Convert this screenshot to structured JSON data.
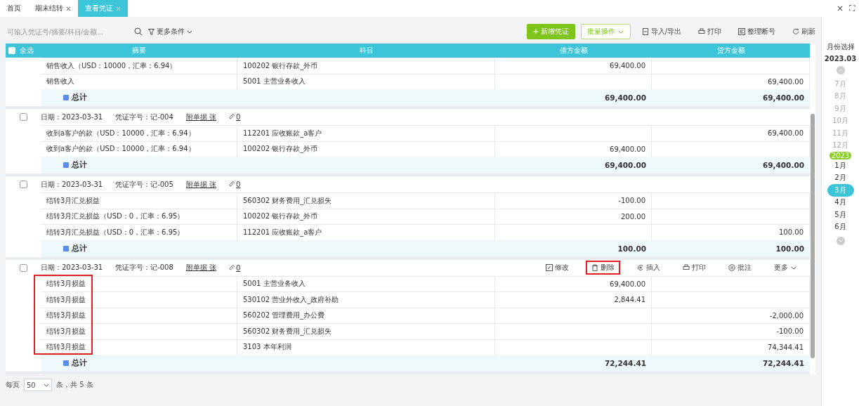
{
  "tabs": [
    {
      "label": "首页",
      "closable": false,
      "selected": false
    },
    {
      "label": "期末结转",
      "closable": true,
      "selected": false
    },
    {
      "label": "查看凭证",
      "closable": true,
      "selected": true
    }
  ],
  "window_controls": [
    "×",
    "⛶"
  ],
  "search": {
    "placeholder": "可输入凭证号/摘要/科目/金额..."
  },
  "filter": {
    "label": "更多条件"
  },
  "toolbar": [
    {
      "label": "新增凭证",
      "kind": "primary"
    },
    {
      "label": "批量操作",
      "kind": "outline"
    },
    {
      "label": "导入/导出",
      "kind": "import"
    },
    {
      "label": "打印",
      "kind": "print"
    },
    {
      "label": "整理断号",
      "kind": "renumber"
    },
    {
      "label": "刷新",
      "kind": "refresh"
    }
  ],
  "table": {
    "select_all": {
      "label": "全选",
      "checked": false
    },
    "columns": [
      "摘要",
      "科目",
      "借方金额",
      "贷方金额"
    ],
    "groups": [
      {
        "rows": [
          {
            "summary": "销售收入（USD：10000，汇率：6.94）",
            "account": "100202 银行存款_外币",
            "debit": "69,400.00",
            "credit": ""
          },
          {
            "summary": "销售收入",
            "account": "5001 主营业务收入",
            "debit": "",
            "credit": "69,400.00"
          }
        ],
        "total": {
          "label": "总计",
          "debit": "69,400.00",
          "credit": "69,400.00"
        }
      },
      {
        "header": {
          "date": "日期：2023-03-31",
          "number": "凭证字号：记-004",
          "attachments": "附单据 张",
          "files": "0"
        },
        "checked": false,
        "rows": [
          {
            "summary": "收到a客户的款（USD：10000，汇率：6.94）",
            "account": "112201 应收账款_a客户",
            "debit": "",
            "credit": "69,400.00"
          },
          {
            "summary": "收到a客户的款（USD：10000，汇率：6.94）",
            "account": "100202 银行存款_外币",
            "debit": "69,400.00",
            "credit": ""
          }
        ],
        "total": {
          "label": "总计",
          "debit": "69,400.00",
          "credit": "69,400.00"
        }
      },
      {
        "header": {
          "date": "日期：2023-03-31",
          "number": "凭证字号：记-005",
          "attachments": "附单据 张",
          "files": "0"
        },
        "checked": false,
        "rows": [
          {
            "summary": "结转3月汇兑损益",
            "account": "560302 财务费用_汇兑损失",
            "debit": "-100.00",
            "credit": ""
          },
          {
            "summary": "结转3月汇兑损益（USD：0，汇率：6.95）",
            "account": "100202 银行存款_外币",
            "debit": "200.00",
            "credit": ""
          },
          {
            "summary": "结转3月汇兑损益（USD：0，汇率：6.95）",
            "account": "112201 应收账款_a客户",
            "debit": "",
            "credit": "100.00"
          }
        ],
        "total": {
          "label": "总计",
          "debit": "100.00",
          "credit": "100.00"
        }
      },
      {
        "header": {
          "date": "日期：2023-03-31",
          "number": "凭证字号：记-008",
          "attachments": "附单据 张",
          "files": "0"
        },
        "checked": false,
        "highlighted": true,
        "actions": [
          {
            "label": "修改",
            "kind": "edit",
            "highlighted": false
          },
          {
            "label": "删除",
            "kind": "delete",
            "highlighted": true
          },
          {
            "label": "插入",
            "kind": "insert",
            "highlighted": false
          },
          {
            "label": "打印",
            "kind": "print",
            "highlighted": false
          },
          {
            "label": "批注",
            "kind": "note",
            "highlighted": false
          },
          {
            "label": "更多",
            "kind": "more",
            "highlighted": false
          }
        ],
        "rows": [
          {
            "summary": "结转3月损益",
            "account": "5001 主营业务收入",
            "debit": "69,400.00",
            "credit": ""
          },
          {
            "summary": "结转3月损益",
            "account": "530102 营业外收入_政府补助",
            "debit": "2,844.41",
            "credit": ""
          },
          {
            "summary": "结转3月损益",
            "account": "560202 管理费用_办公费",
            "debit": "",
            "credit": "-2,000.00"
          },
          {
            "summary": "结转3月损益",
            "account": "560302 财务费用_汇兑损失",
            "debit": "",
            "credit": "-100.00"
          },
          {
            "summary": "结转3月损益",
            "account": "3103 本年利润",
            "debit": "",
            "credit": "74,344.41"
          }
        ],
        "total": {
          "label": "总计",
          "debit": "72,244.41",
          "credit": "72,244.41"
        }
      }
    ]
  },
  "pagination": {
    "per_page_label": "每页",
    "per_page": "50",
    "count_text": "条，共 5 条"
  },
  "month_picker": {
    "title": "月份选择",
    "value": "2023.03",
    "year_badge": "2023",
    "months": [
      {
        "label": "7月",
        "current_year": false,
        "selected": false
      },
      {
        "label": "8月",
        "current_year": false,
        "selected": false
      },
      {
        "label": "9月",
        "current_year": false,
        "selected": false
      },
      {
        "label": "10月",
        "current_year": false,
        "selected": false
      },
      {
        "label": "11月",
        "current_year": false,
        "selected": false
      },
      {
        "label": "12月",
        "current_year": false,
        "selected": false
      },
      {
        "label": "1月",
        "current_year": true,
        "selected": false
      },
      {
        "label": "2月",
        "current_year": true,
        "selected": false
      },
      {
        "label": "3月",
        "current_year": true,
        "selected": true
      },
      {
        "label": "4月",
        "current_year": true,
        "selected": false
      },
      {
        "label": "5月",
        "current_year": true,
        "selected": false
      },
      {
        "label": "6月",
        "current_year": true,
        "selected": false
      }
    ]
  }
}
